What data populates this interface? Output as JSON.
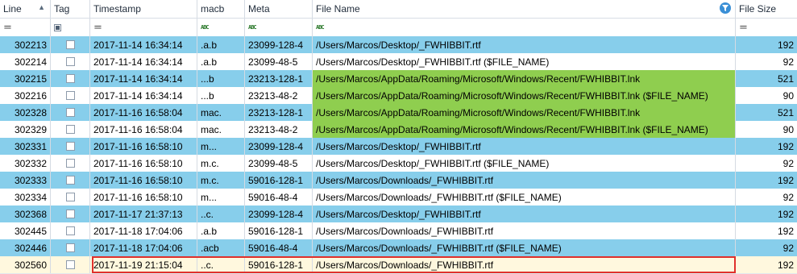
{
  "columns": {
    "line": "Line",
    "tag": "Tag",
    "timestamp": "Timestamp",
    "macb": "macb",
    "meta": "Meta",
    "file_name": "File Name",
    "file_size": "File Size"
  },
  "icons": {
    "sort": "sort-up-icon",
    "filter": "filter-funnel-icon",
    "equals": "equals-icon",
    "abc": "text-filter-icon"
  },
  "filter_row": {
    "equals": "=",
    "abc": "ABC"
  },
  "colors": {
    "row_blue": "#87ceeb",
    "row_white": "#ffffff",
    "row_selected": "#fff8de",
    "highlight_green": "#8fce4f",
    "selection_outline": "#e0302b"
  },
  "rows": [
    {
      "line": "302213",
      "timestamp": "2017-11-14 16:34:14",
      "macb": ".a.b",
      "meta": "23099-128-4",
      "file_name": "/Users/Marcos/Desktop/_FWHIBBIT.rtf",
      "file_size": "192",
      "style": "blue",
      "file_green": false
    },
    {
      "line": "302214",
      "timestamp": "2017-11-14 16:34:14",
      "macb": ".a.b",
      "meta": "23099-48-5",
      "file_name": "/Users/Marcos/Desktop/_FWHIBBIT.rtf ($FILE_NAME)",
      "file_size": "92",
      "style": "white",
      "file_green": false
    },
    {
      "line": "302215",
      "timestamp": "2017-11-14 16:34:14",
      "macb": "...b",
      "meta": "23213-128-1",
      "file_name": "/Users/Marcos/AppData/Roaming/Microsoft/Windows/Recent/FWHIBBIT.lnk",
      "file_size": "521",
      "style": "blue",
      "file_green": true
    },
    {
      "line": "302216",
      "timestamp": "2017-11-14 16:34:14",
      "macb": "...b",
      "meta": "23213-48-2",
      "file_name": "/Users/Marcos/AppData/Roaming/Microsoft/Windows/Recent/FWHIBBIT.lnk ($FILE_NAME)",
      "file_size": "90",
      "style": "white",
      "file_green": true
    },
    {
      "line": "302328",
      "timestamp": "2017-11-16 16:58:04",
      "macb": "mac.",
      "meta": "23213-128-1",
      "file_name": "/Users/Marcos/AppData/Roaming/Microsoft/Windows/Recent/FWHIBBIT.lnk",
      "file_size": "521",
      "style": "blue",
      "file_green": true
    },
    {
      "line": "302329",
      "timestamp": "2017-11-16 16:58:04",
      "macb": "mac.",
      "meta": "23213-48-2",
      "file_name": "/Users/Marcos/AppData/Roaming/Microsoft/Windows/Recent/FWHIBBIT.lnk ($FILE_NAME)",
      "file_size": "90",
      "style": "white",
      "file_green": true
    },
    {
      "line": "302331",
      "timestamp": "2017-11-16 16:58:10",
      "macb": "m...",
      "meta": "23099-128-4",
      "file_name": "/Users/Marcos/Desktop/_FWHIBBIT.rtf",
      "file_size": "192",
      "style": "blue",
      "file_green": false
    },
    {
      "line": "302332",
      "timestamp": "2017-11-16 16:58:10",
      "macb": "m.c.",
      "meta": "23099-48-5",
      "file_name": "/Users/Marcos/Desktop/_FWHIBBIT.rtf ($FILE_NAME)",
      "file_size": "92",
      "style": "white",
      "file_green": false
    },
    {
      "line": "302333",
      "timestamp": "2017-11-16 16:58:10",
      "macb": "m.c.",
      "meta": "59016-128-1",
      "file_name": "/Users/Marcos/Downloads/_FWHIBBIT.rtf",
      "file_size": "192",
      "style": "blue",
      "file_green": false
    },
    {
      "line": "302334",
      "timestamp": "2017-11-16 16:58:10",
      "macb": "m...",
      "meta": "59016-48-4",
      "file_name": "/Users/Marcos/Downloads/_FWHIBBIT.rtf ($FILE_NAME)",
      "file_size": "92",
      "style": "white",
      "file_green": false
    },
    {
      "line": "302368",
      "timestamp": "2017-11-17 21:37:13",
      "macb": "..c.",
      "meta": "23099-128-4",
      "file_name": "/Users/Marcos/Desktop/_FWHIBBIT.rtf",
      "file_size": "192",
      "style": "blue",
      "file_green": false
    },
    {
      "line": "302445",
      "timestamp": "2017-11-18 17:04:06",
      "macb": ".a.b",
      "meta": "59016-128-1",
      "file_name": "/Users/Marcos/Downloads/_FWHIBBIT.rtf",
      "file_size": "192",
      "style": "white",
      "file_green": false
    },
    {
      "line": "302446",
      "timestamp": "2017-11-18 17:04:06",
      "macb": ".acb",
      "meta": "59016-48-4",
      "file_name": "/Users/Marcos/Downloads/_FWHIBBIT.rtf ($FILE_NAME)",
      "file_size": "92",
      "style": "blue",
      "file_green": false
    },
    {
      "line": "302560",
      "timestamp": "2017-11-19 21:15:04",
      "macb": "..c.",
      "meta": "59016-128-1",
      "file_name": "/Users/Marcos/Downloads/_FWHIBBIT.rtf",
      "file_size": "192",
      "style": "cream",
      "file_green": false
    }
  ]
}
